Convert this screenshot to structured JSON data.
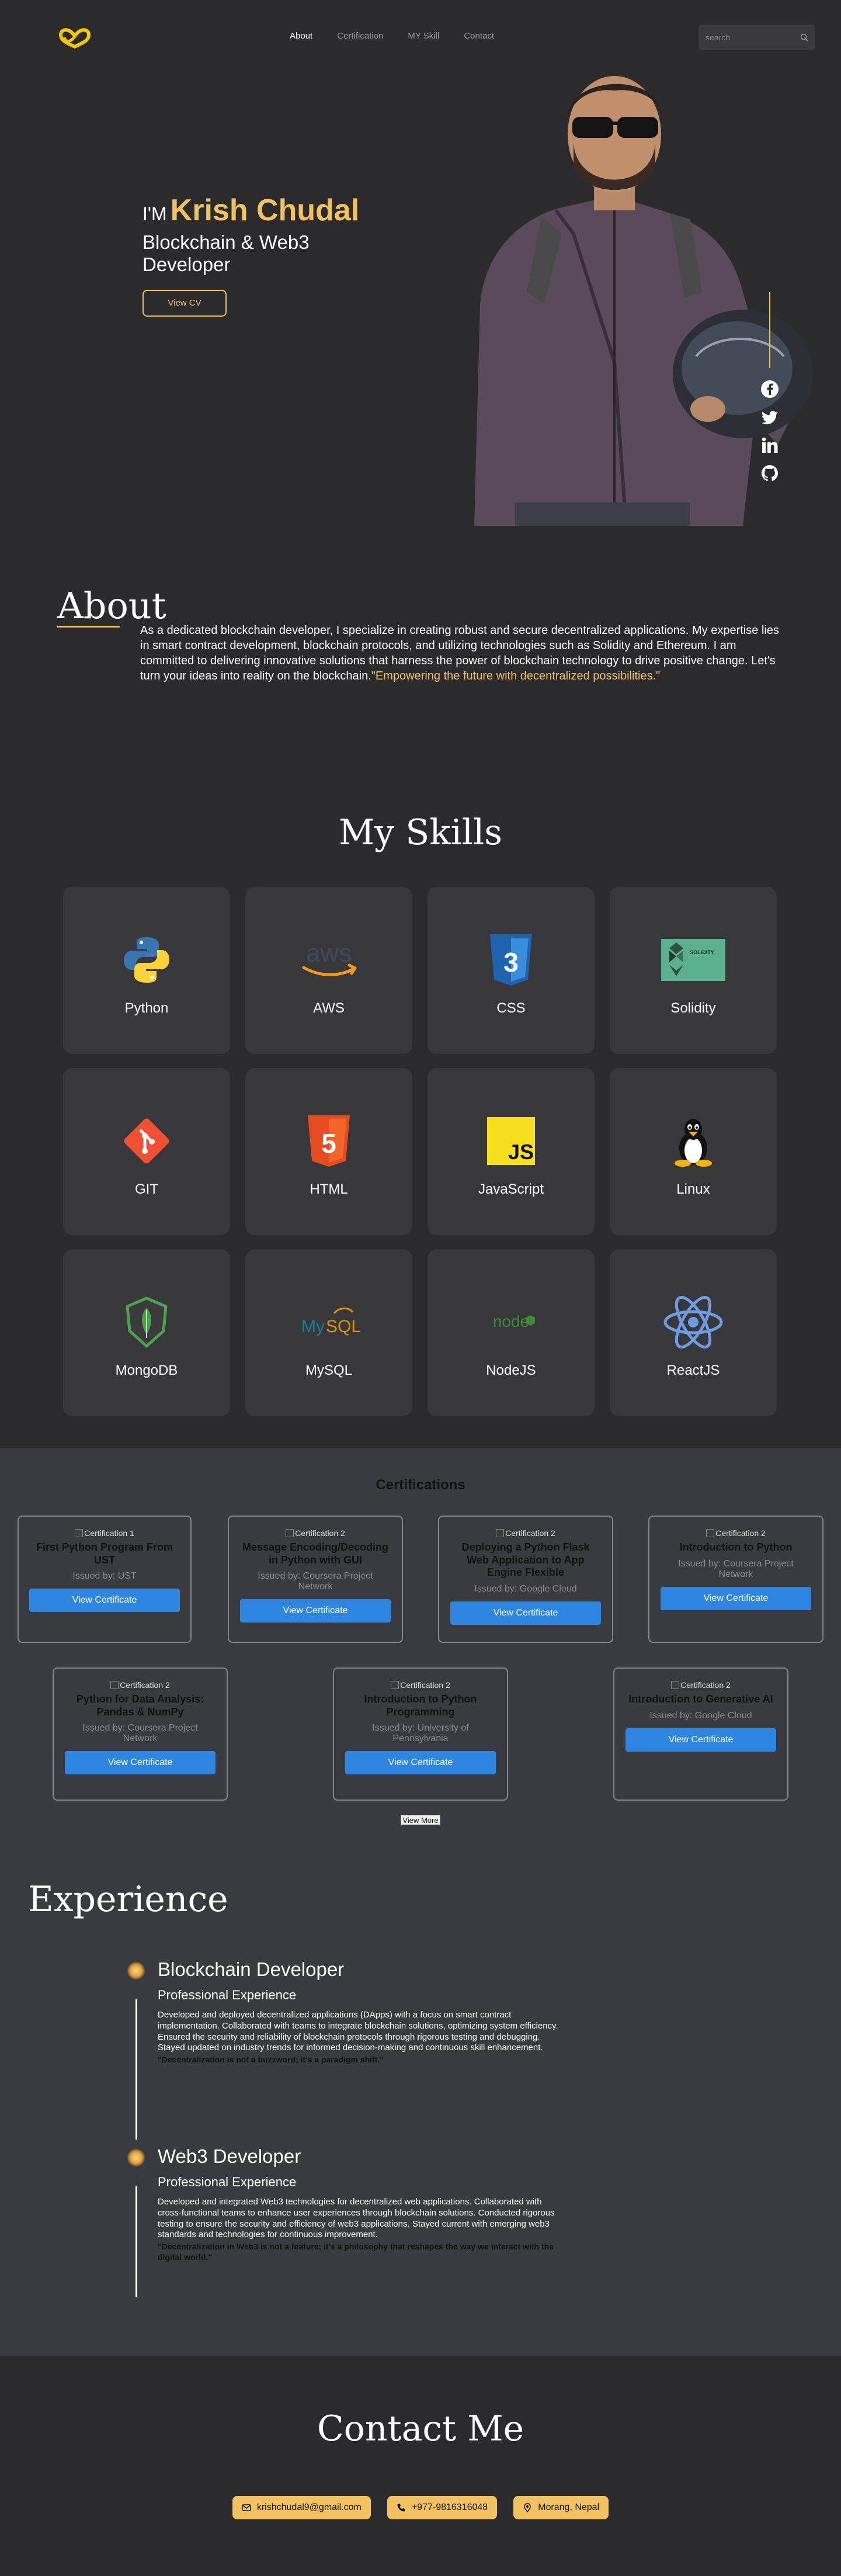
{
  "nav": {
    "links": [
      "About",
      "Certification",
      "MY Skill",
      "Contact"
    ],
    "search_placeholder": "search"
  },
  "hero": {
    "greeting": "I'M",
    "name": "Krish Chudal",
    "role": "Blockchain & Web3 Developer",
    "cv_button": "View CV"
  },
  "about": {
    "title": "About",
    "text": "As a dedicated blockchain developer, I specialize in creating robust and secure decentralized applications. My expertise lies in smart contract development, blockchain protocols, and utilizing technologies such as Solidity and Ethereum. I am committed to delivering innovative solutions that harness the power of blockchain technology to drive positive change. Let's turn your ideas into reality on the blockchain.",
    "quote": "\"Empowering the future with decentralized possibilities.\""
  },
  "skills": {
    "title": "My Skills",
    "items": [
      {
        "name": "Python",
        "icon": "python-icon"
      },
      {
        "name": "AWS",
        "icon": "aws-icon"
      },
      {
        "name": "CSS",
        "icon": "css-icon"
      },
      {
        "name": "Solidity",
        "icon": "solidity-icon"
      },
      {
        "name": "GIT",
        "icon": "git-icon"
      },
      {
        "name": "HTML",
        "icon": "html-icon"
      },
      {
        "name": "JavaScript",
        "icon": "javascript-icon"
      },
      {
        "name": "Linux",
        "icon": "linux-icon"
      },
      {
        "name": "MongoDB",
        "icon": "mongodb-icon"
      },
      {
        "name": "MySQL",
        "icon": "mysql-icon"
      },
      {
        "name": "NodeJS",
        "icon": "nodejs-icon"
      },
      {
        "name": "ReactJS",
        "icon": "reactjs-icon"
      }
    ],
    "solidity_logo_text": "SOLIDITY"
  },
  "certifications": {
    "title": "Certifications",
    "button_label": "View Certificate",
    "view_more": "View More",
    "items": [
      {
        "alt": "Certification 1",
        "name": "First Python Program From UST",
        "issuer": "Issued by: UST"
      },
      {
        "alt": "Certification 2",
        "name": "Message Encoding/Decoding in Python with GUI",
        "issuer": "Issued by: Coursera Project Network"
      },
      {
        "alt": "Certification 2",
        "name": "Deploying a Python Flask Web Application to App Engine Flexible",
        "issuer": "Issued by: Google Cloud"
      },
      {
        "alt": "Certification 2",
        "name": "Introduction to Python",
        "issuer": "Issued by: Coursera Project Network"
      },
      {
        "alt": "Certification 2",
        "name": "Python for Data Analysis: Pandas & NumPy",
        "issuer": "Issued by: Coursera Project Network"
      },
      {
        "alt": "Certification 2",
        "name": "Introduction to Python Programming",
        "issuer": "Issued by: University of Pennsylvania"
      },
      {
        "alt": "Certification 2",
        "name": "Introduction to Generative AI",
        "issuer": "Issued by: Google Cloud"
      }
    ]
  },
  "experience": {
    "title": "Experience",
    "items": [
      {
        "role": "Blockchain Developer",
        "subtitle": "Professional Experience",
        "description": "Developed and deployed decentralized applications (DApps) with a focus on smart contract implementation. Collaborated with teams to integrate blockchain solutions, optimizing system efficiency. Ensured the security and reliability of blockchain protocols through rigorous testing and debugging. Stayed updated on industry trends for informed decision-making and continuous skill enhancement.",
        "quote": "\"Decentralization is not a buzzword; it's a paradigm shift.\""
      },
      {
        "role": "Web3 Developer",
        "subtitle": "Professional Experience",
        "description": "Developed and integrated Web3 technologies for decentralized web applications. Collaborated with cross-functional teams to enhance user experiences through blockchain solutions. Conducted rigorous testing to ensure the security and efficiency of web3 applications. Stayed current with emerging web3 standards and technologies for continuous improvement.",
        "quote": "\"Decentralization in Web3 is not a feature; it's a philosophy that reshapes the way we interact with the digital world.\""
      }
    ]
  },
  "contact": {
    "title": "Contact Me",
    "email": "krishchudal9@gmail.com",
    "phone": "+977-9816316048",
    "location": "Morang, Nepal"
  },
  "colors": {
    "accent": "#f2c261",
    "background": "#2b2b2e",
    "card": "#38383c",
    "button_blue": "#2f86e0"
  }
}
